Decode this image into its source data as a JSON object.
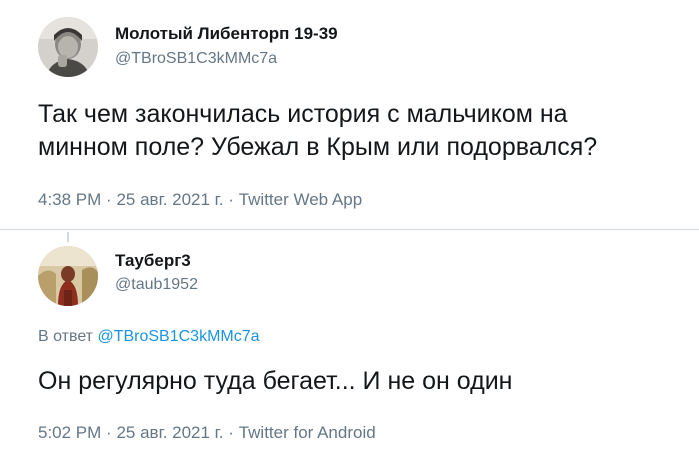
{
  "tweets": [
    {
      "display_name": "Молотый Либенторп 19-39",
      "handle": "@TBroSB1C3kMMc7a",
      "text_lines": [
        "Так чем закончилась история с мальчиком на",
        "минном поле? Убежал в Крым или подорвался?"
      ],
      "time": "4:38 PM",
      "date": "25 авг. 2021 г.",
      "source": "Twitter Web App",
      "separator": "·"
    },
    {
      "display_name": "Тауберг3",
      "handle": "@taub1952",
      "reply_prefix": "В ответ",
      "reply_mention": "@TBroSB1C3kMMc7a",
      "text_lines": [
        "Он регулярно туда бегает... И не он один"
      ],
      "time": "5:02 PM",
      "date": "25 авг. 2021 г.",
      "source": "Twitter for Android",
      "separator": "·"
    }
  ],
  "colors": {
    "text": "#14171a",
    "secondary": "#657786",
    "link": "#1b95e0",
    "divider": "#cfd9de"
  }
}
